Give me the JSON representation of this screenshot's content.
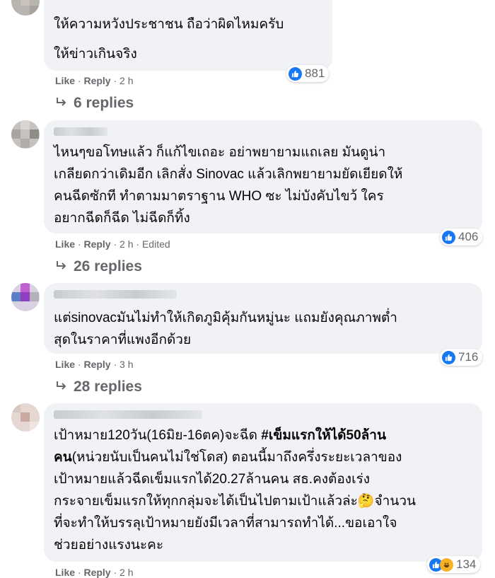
{
  "comments": [
    {
      "text_lines": [
        "ให้ความหวังประชาชน ถือว่าผิดไหมครับ",
        "ให้ข่าวเกินจริง"
      ],
      "reaction_count": "881",
      "actions": {
        "like": "Like",
        "reply": "Reply",
        "time": "2 h",
        "edited": ""
      },
      "replies_label": "6 replies"
    },
    {
      "text_lines": [
        "ไหนๆขอโทษแล้ว ก็แก้ไขเถอะ อย่าพยายามแถเลย มันดูน่า",
        "เกลียดกว่าเดิมอีก เลิกสั่ง Sinovac แล้วเลิกพยายามยัดเยียดให้",
        "คนฉีดซักที ทำตามมาตราฐาน WHO ซะ ไม่บังคับไขว้ ใคร",
        "อยากฉีดก็ฉีด ไม่ฉีดก็ทิ้ง"
      ],
      "reaction_count": "406",
      "actions": {
        "like": "Like",
        "reply": "Reply",
        "time": "2 h",
        "edited": "Edited"
      },
      "replies_label": "26 replies"
    },
    {
      "text_lines": [
        "แต่sinovacมันไม่ทำให้เกิดภูมิคุ้มกันหมู่นะ แถมยังคุณภาพต่ำ",
        "สุดในราคาที่แพงอีกด้วย"
      ],
      "reaction_count": "716",
      "actions": {
        "like": "Like",
        "reply": "Reply",
        "time": "3 h",
        "edited": ""
      },
      "replies_label": "28 replies"
    },
    {
      "text_line1_a": "เป้าหมาย120วัน(16มิย-16ตค)จะฉีด ",
      "text_line1_b": "#เข็มแรกให้ได้50ล้าน",
      "text_line2_a": "คน",
      "text_line2_b": "(หน่วยนับเป็นคนไม่ใช่โดส) ตอนนี้มาถึงครึ่งระยะเวลาของ",
      "text_lines_rest": [
        "เป้าหมายแล้วฉีดเข็มแรกได้20.27ล้านคน สธ.คงต้องเร่ง",
        "กระจายเข็มแรกให้ทุกกลุ่มจะได้เป็นไปตามเป้าแล้วล่ะ🤔จำนวน",
        "ที่จะทำให้บรรลุเป้าหมายยังมีเวลาที่สามารถทำได้...ขอเอาใจ",
        "ช่วยอย่างแรงนะคะ"
      ],
      "reaction_count": "134",
      "actions": {
        "like": "Like",
        "reply": "Reply",
        "time": "2 h",
        "edited": ""
      }
    }
  ],
  "separator": "·",
  "colors": {
    "like_blue": "#1877f2",
    "bubble": "#f0f2f5",
    "meta_gray": "#65676b"
  }
}
